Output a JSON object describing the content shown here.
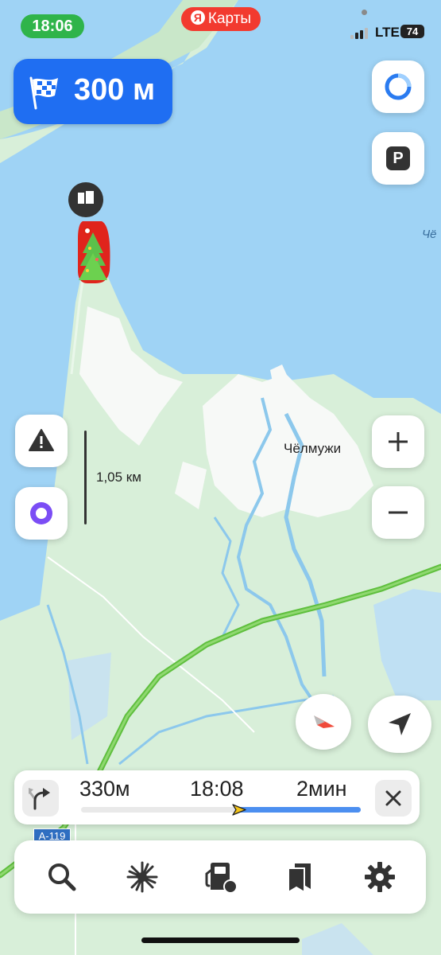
{
  "status_bar": {
    "time": "18:06",
    "app_badge": "Карты",
    "app_badge_logo": "Я",
    "network": "LTE",
    "battery": "74"
  },
  "maneuver": {
    "icon": "checkered-flag-icon",
    "distance": "300 м"
  },
  "map": {
    "scale_label": "1,05 км",
    "place_label": "Чёлмужи",
    "edge_label": "Чё",
    "road_shield": "А-119"
  },
  "route_panel": {
    "turn_icon": "turn-right-icon",
    "next_distance": "330м",
    "arrival_time": "18:08",
    "duration": "2мин",
    "progress": 0.56
  },
  "toolbar": {
    "items": [
      {
        "name": "search",
        "icon": "search-icon"
      },
      {
        "name": "overview",
        "icon": "starburst-icon"
      },
      {
        "name": "gas-stations",
        "icon": "fuel-icon"
      },
      {
        "name": "bookmarks",
        "icon": "bookmarks-icon"
      },
      {
        "name": "settings",
        "icon": "gear-icon"
      }
    ]
  },
  "colors": {
    "water": "#9fd3f5",
    "land": "#d8efd9",
    "accent": "#1f6ef2",
    "route": "#4c8ff0",
    "status_time": "#2fb44a",
    "brand": "#f23a2f"
  }
}
